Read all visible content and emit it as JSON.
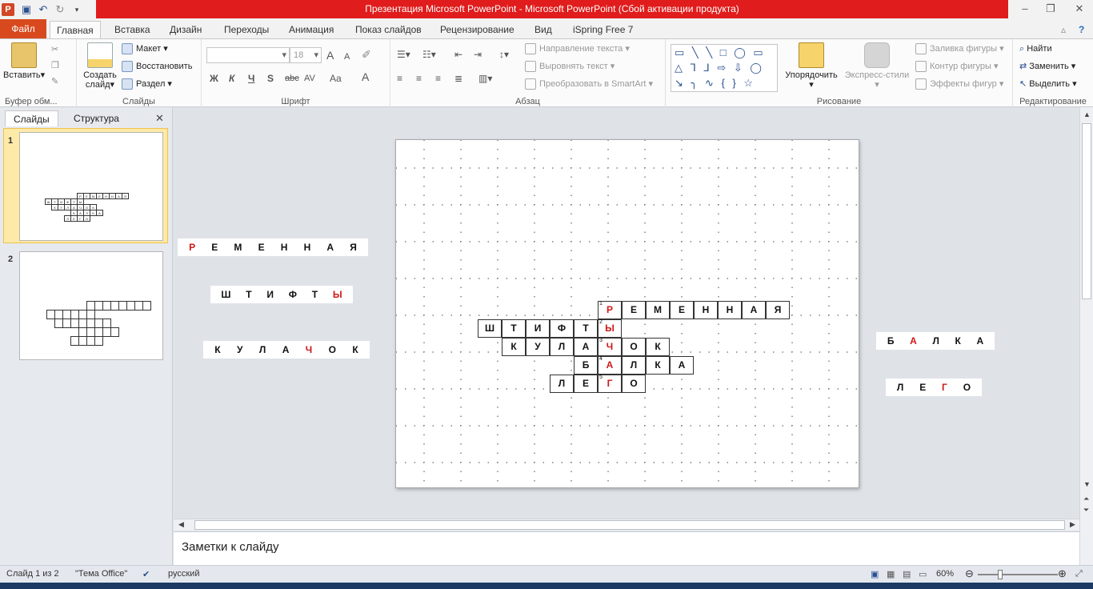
{
  "window": {
    "title": "Презентация Microsoft PowerPoint  -  Microsoft PowerPoint (Сбой активации продукта)"
  },
  "ribbon_tabs": [
    {
      "label": "Файл"
    },
    {
      "label": "Главная"
    },
    {
      "label": "Вставка"
    },
    {
      "label": "Дизайн"
    },
    {
      "label": "Переходы"
    },
    {
      "label": "Анимация"
    },
    {
      "label": "Показ слайдов"
    },
    {
      "label": "Рецензирование"
    },
    {
      "label": "Вид"
    },
    {
      "label": "iSpring Free 7"
    }
  ],
  "ribbon": {
    "clipboard": {
      "paste": "Вставить",
      "label": "Буфер обм..."
    },
    "slides": {
      "create": "Создать",
      "create2": "слайд",
      "layout": "Макет",
      "reset": "Восстановить",
      "section": "Раздел",
      "label": "Слайды"
    },
    "font": {
      "size": "18",
      "label": "Шрифт",
      "bold": "Ж",
      "italic": "К",
      "underline": "Ч",
      "shadow": "S",
      "strike": "abc",
      "spacing": "AV",
      "case": "Aa",
      "color": "A",
      "grow": "A",
      "shrink": "A"
    },
    "paragraph": {
      "direction": "Направление текста",
      "align": "Выровнять текст",
      "smartart": "Преобразовать в SmartArt",
      "label": "Абзац"
    },
    "drawing": {
      "arrange": "Упорядочить",
      "styles": "Экспресс-стили",
      "fill": "Заливка фигуры",
      "outline": "Контур фигуры",
      "effects": "Эффекты фигур",
      "label": "Рисование",
      "shapes": "▭ ╲ ╲ □ ◯ ▭ △ ⅂ ⅃ ⇨ ⇩ ◯ ↘ ╮ ∿ { } ☆"
    },
    "editing": {
      "find": "Найти",
      "replace": "Заменить",
      "select": "Выделить",
      "label": "Редактирование"
    }
  },
  "left_panel": {
    "tab_slides": "Слайды",
    "tab_outline": "Структура",
    "slide_numbers": [
      "1",
      "2"
    ]
  },
  "crossword": {
    "rows": [
      {
        "cells": [
          {
            "ch": "Р",
            "num": "1",
            "red": true
          },
          {
            "ch": "Е"
          },
          {
            "ch": "М"
          },
          {
            "ch": "Е"
          },
          {
            "ch": "Н"
          },
          {
            "ch": "Н"
          },
          {
            "ch": "А"
          },
          {
            "ch": "Я"
          }
        ]
      },
      {
        "cells": [
          {
            "ch": "Ш"
          },
          {
            "ch": "Т"
          },
          {
            "ch": "И"
          },
          {
            "ch": "Ф"
          },
          {
            "ch": "Т"
          },
          {
            "ch": "Ы",
            "num": "2",
            "red": true
          }
        ]
      },
      {
        "cells": [
          {
            "ch": "К"
          },
          {
            "ch": "У"
          },
          {
            "ch": "Л"
          },
          {
            "ch": "А"
          },
          {
            "ch": "Ч",
            "num": "3",
            "red": true
          },
          {
            "ch": "О"
          },
          {
            "ch": "К"
          }
        ]
      },
      {
        "cells": [
          {
            "ch": "Б"
          },
          {
            "ch": "А",
            "num": "4",
            "red": true
          },
          {
            "ch": "Л"
          },
          {
            "ch": "К"
          },
          {
            "ch": "А"
          }
        ]
      },
      {
        "cells": [
          {
            "ch": "Л"
          },
          {
            "ch": "Е"
          },
          {
            "ch": "Г",
            "num": "5",
            "red": true
          },
          {
            "ch": "О"
          }
        ]
      }
    ]
  },
  "word_boxes": [
    {
      "letters": [
        {
          "ch": "Р",
          "red": true
        },
        {
          "ch": "Е"
        },
        {
          "ch": "М"
        },
        {
          "ch": "Е"
        },
        {
          "ch": "Н"
        },
        {
          "ch": "Н"
        },
        {
          "ch": "А"
        },
        {
          "ch": "Я"
        }
      ]
    },
    {
      "letters": [
        {
          "ch": "Ш"
        },
        {
          "ch": "Т"
        },
        {
          "ch": "И"
        },
        {
          "ch": "Ф"
        },
        {
          "ch": "Т"
        },
        {
          "ch": "Ы",
          "red": true
        }
      ]
    },
    {
      "letters": [
        {
          "ch": "К"
        },
        {
          "ch": "У"
        },
        {
          "ch": "Л"
        },
        {
          "ch": "А"
        },
        {
          "ch": "Ч",
          "red": true
        },
        {
          "ch": "О"
        },
        {
          "ch": "К"
        }
      ]
    },
    {
      "letters": [
        {
          "ch": "Б"
        },
        {
          "ch": "А",
          "red": true
        },
        {
          "ch": "Л"
        },
        {
          "ch": "К"
        },
        {
          "ch": "А"
        }
      ]
    },
    {
      "letters": [
        {
          "ch": "Л"
        },
        {
          "ch": "Е"
        },
        {
          "ch": "Г",
          "red": true
        },
        {
          "ch": "О"
        }
      ]
    }
  ],
  "notes": {
    "placeholder": "Заметки к слайду"
  },
  "status": {
    "slide": "Слайд 1 из 2",
    "theme": "\"Тема Office\"",
    "language": "русский",
    "zoom": "60%"
  },
  "colors": {
    "accent_red": "#d01818",
    "file_tab": "#d8491e",
    "title_red": "#e01c1c"
  }
}
